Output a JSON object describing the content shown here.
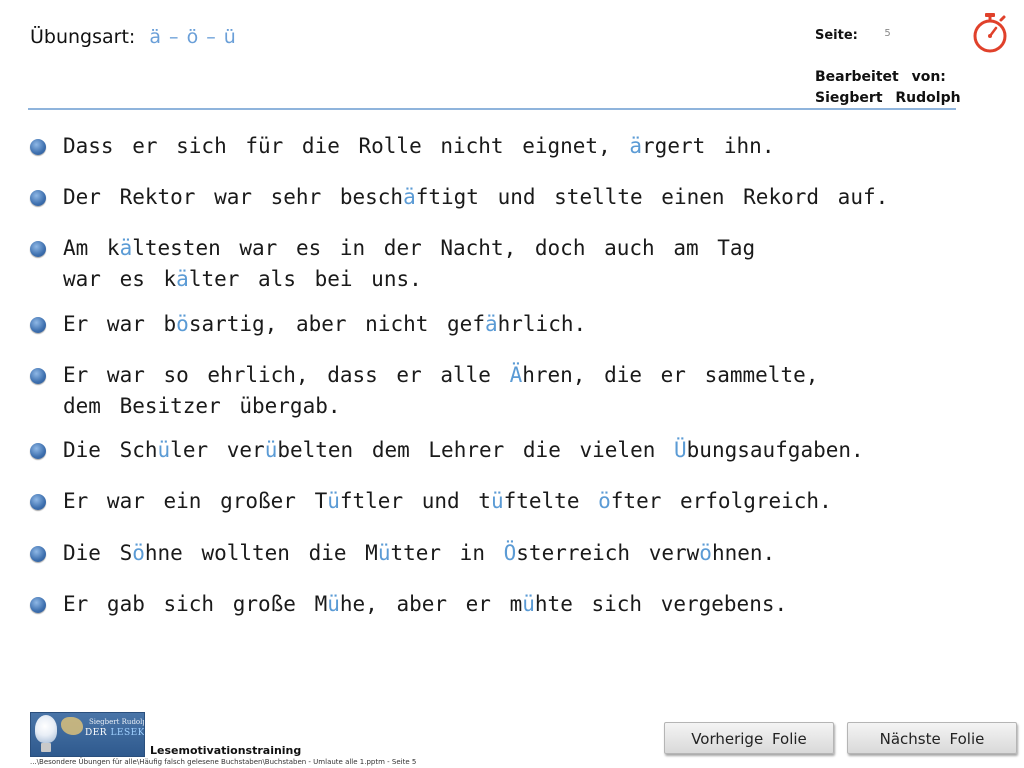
{
  "header": {
    "exercise_label": "Übungsart:",
    "exercise_value": "ä – ö – ü",
    "page_label": "Seite:",
    "page_number": "5",
    "edited_by_line1": "Bearbeitet von:",
    "edited_by_line2": "Siegbert Rudolph",
    "stopwatch_icon": "stopwatch-icon"
  },
  "colors": {
    "highlight": "#5b9bd5",
    "bullet": "#3d6fae",
    "rule": "#8fb4dc",
    "stopwatch": "#e0412b"
  },
  "sentences": [
    {
      "lines": [
        [
          {
            "t": "Dass er sich für die Rolle nicht eignet, "
          },
          {
            "t": "ä",
            "h": true
          },
          {
            "t": "rgert ihn."
          }
        ]
      ]
    },
    {
      "lines": [
        [
          {
            "t": "Der Rektor war sehr besch"
          },
          {
            "t": "ä",
            "h": true
          },
          {
            "t": "ftigt und stellte einen Rekord auf."
          }
        ]
      ]
    },
    {
      "lines": [
        [
          {
            "t": "Am k"
          },
          {
            "t": "ä",
            "h": true
          },
          {
            "t": "ltesten war es in der Nacht, doch auch am Tag"
          }
        ],
        [
          {
            "t": "war es k"
          },
          {
            "t": "ä",
            "h": true
          },
          {
            "t": "lter als bei uns."
          }
        ]
      ]
    },
    {
      "lines": [
        [
          {
            "t": "Er war b"
          },
          {
            "t": "ö",
            "h": true
          },
          {
            "t": "sartig, aber nicht gef"
          },
          {
            "t": "ä",
            "h": true
          },
          {
            "t": "hrlich."
          }
        ]
      ]
    },
    {
      "lines": [
        [
          {
            "t": "Er war so ehrlich, dass er alle "
          },
          {
            "t": "Ä",
            "h": true
          },
          {
            "t": "hren, die er sammelte,"
          }
        ],
        [
          {
            "t": "dem Besitzer übergab."
          }
        ]
      ]
    },
    {
      "lines": [
        [
          {
            "t": "Die Sch"
          },
          {
            "t": "ü",
            "h": true
          },
          {
            "t": "ler ver"
          },
          {
            "t": "ü",
            "h": true
          },
          {
            "t": "belten dem Lehrer die vielen "
          },
          {
            "t": "Ü",
            "h": true
          },
          {
            "t": "bungsaufgaben."
          }
        ]
      ]
    },
    {
      "lines": [
        [
          {
            "t": "Er war ein großer T"
          },
          {
            "t": "ü",
            "h": true
          },
          {
            "t": "ftler und t"
          },
          {
            "t": "ü",
            "h": true
          },
          {
            "t": "ftelte "
          },
          {
            "t": "ö",
            "h": true
          },
          {
            "t": "fter erfolgreich."
          }
        ]
      ]
    },
    {
      "lines": [
        [
          {
            "t": "Die S"
          },
          {
            "t": "ö",
            "h": true
          },
          {
            "t": "hne wollten die M"
          },
          {
            "t": "ü",
            "h": true
          },
          {
            "t": "tter in "
          },
          {
            "t": "Ö",
            "h": true
          },
          {
            "t": "sterreich verw"
          },
          {
            "t": "ö",
            "h": true
          },
          {
            "t": "hnen."
          }
        ]
      ]
    },
    {
      "lines": [
        [
          {
            "t": "Er gab sich große M"
          },
          {
            "t": "ü",
            "h": true
          },
          {
            "t": "he, aber er m"
          },
          {
            "t": "ü",
            "h": true
          },
          {
            "t": "hte sich vergebens."
          }
        ]
      ]
    }
  ],
  "footer": {
    "logo_name1": "Siegbert Rudolph",
    "logo_name2_a": "DER ",
    "logo_name2_b": "LESEKOCH",
    "title": "Lesemotivationstraining",
    "path": "...\\Besondere Übungen für alle\\Häufig falsch gelesene Buchstaben\\Buchstaben - Umlaute alle 1.pptm - Seite 5",
    "prev_label": "Vorherige Folie",
    "next_label": "Nächste Folie"
  }
}
